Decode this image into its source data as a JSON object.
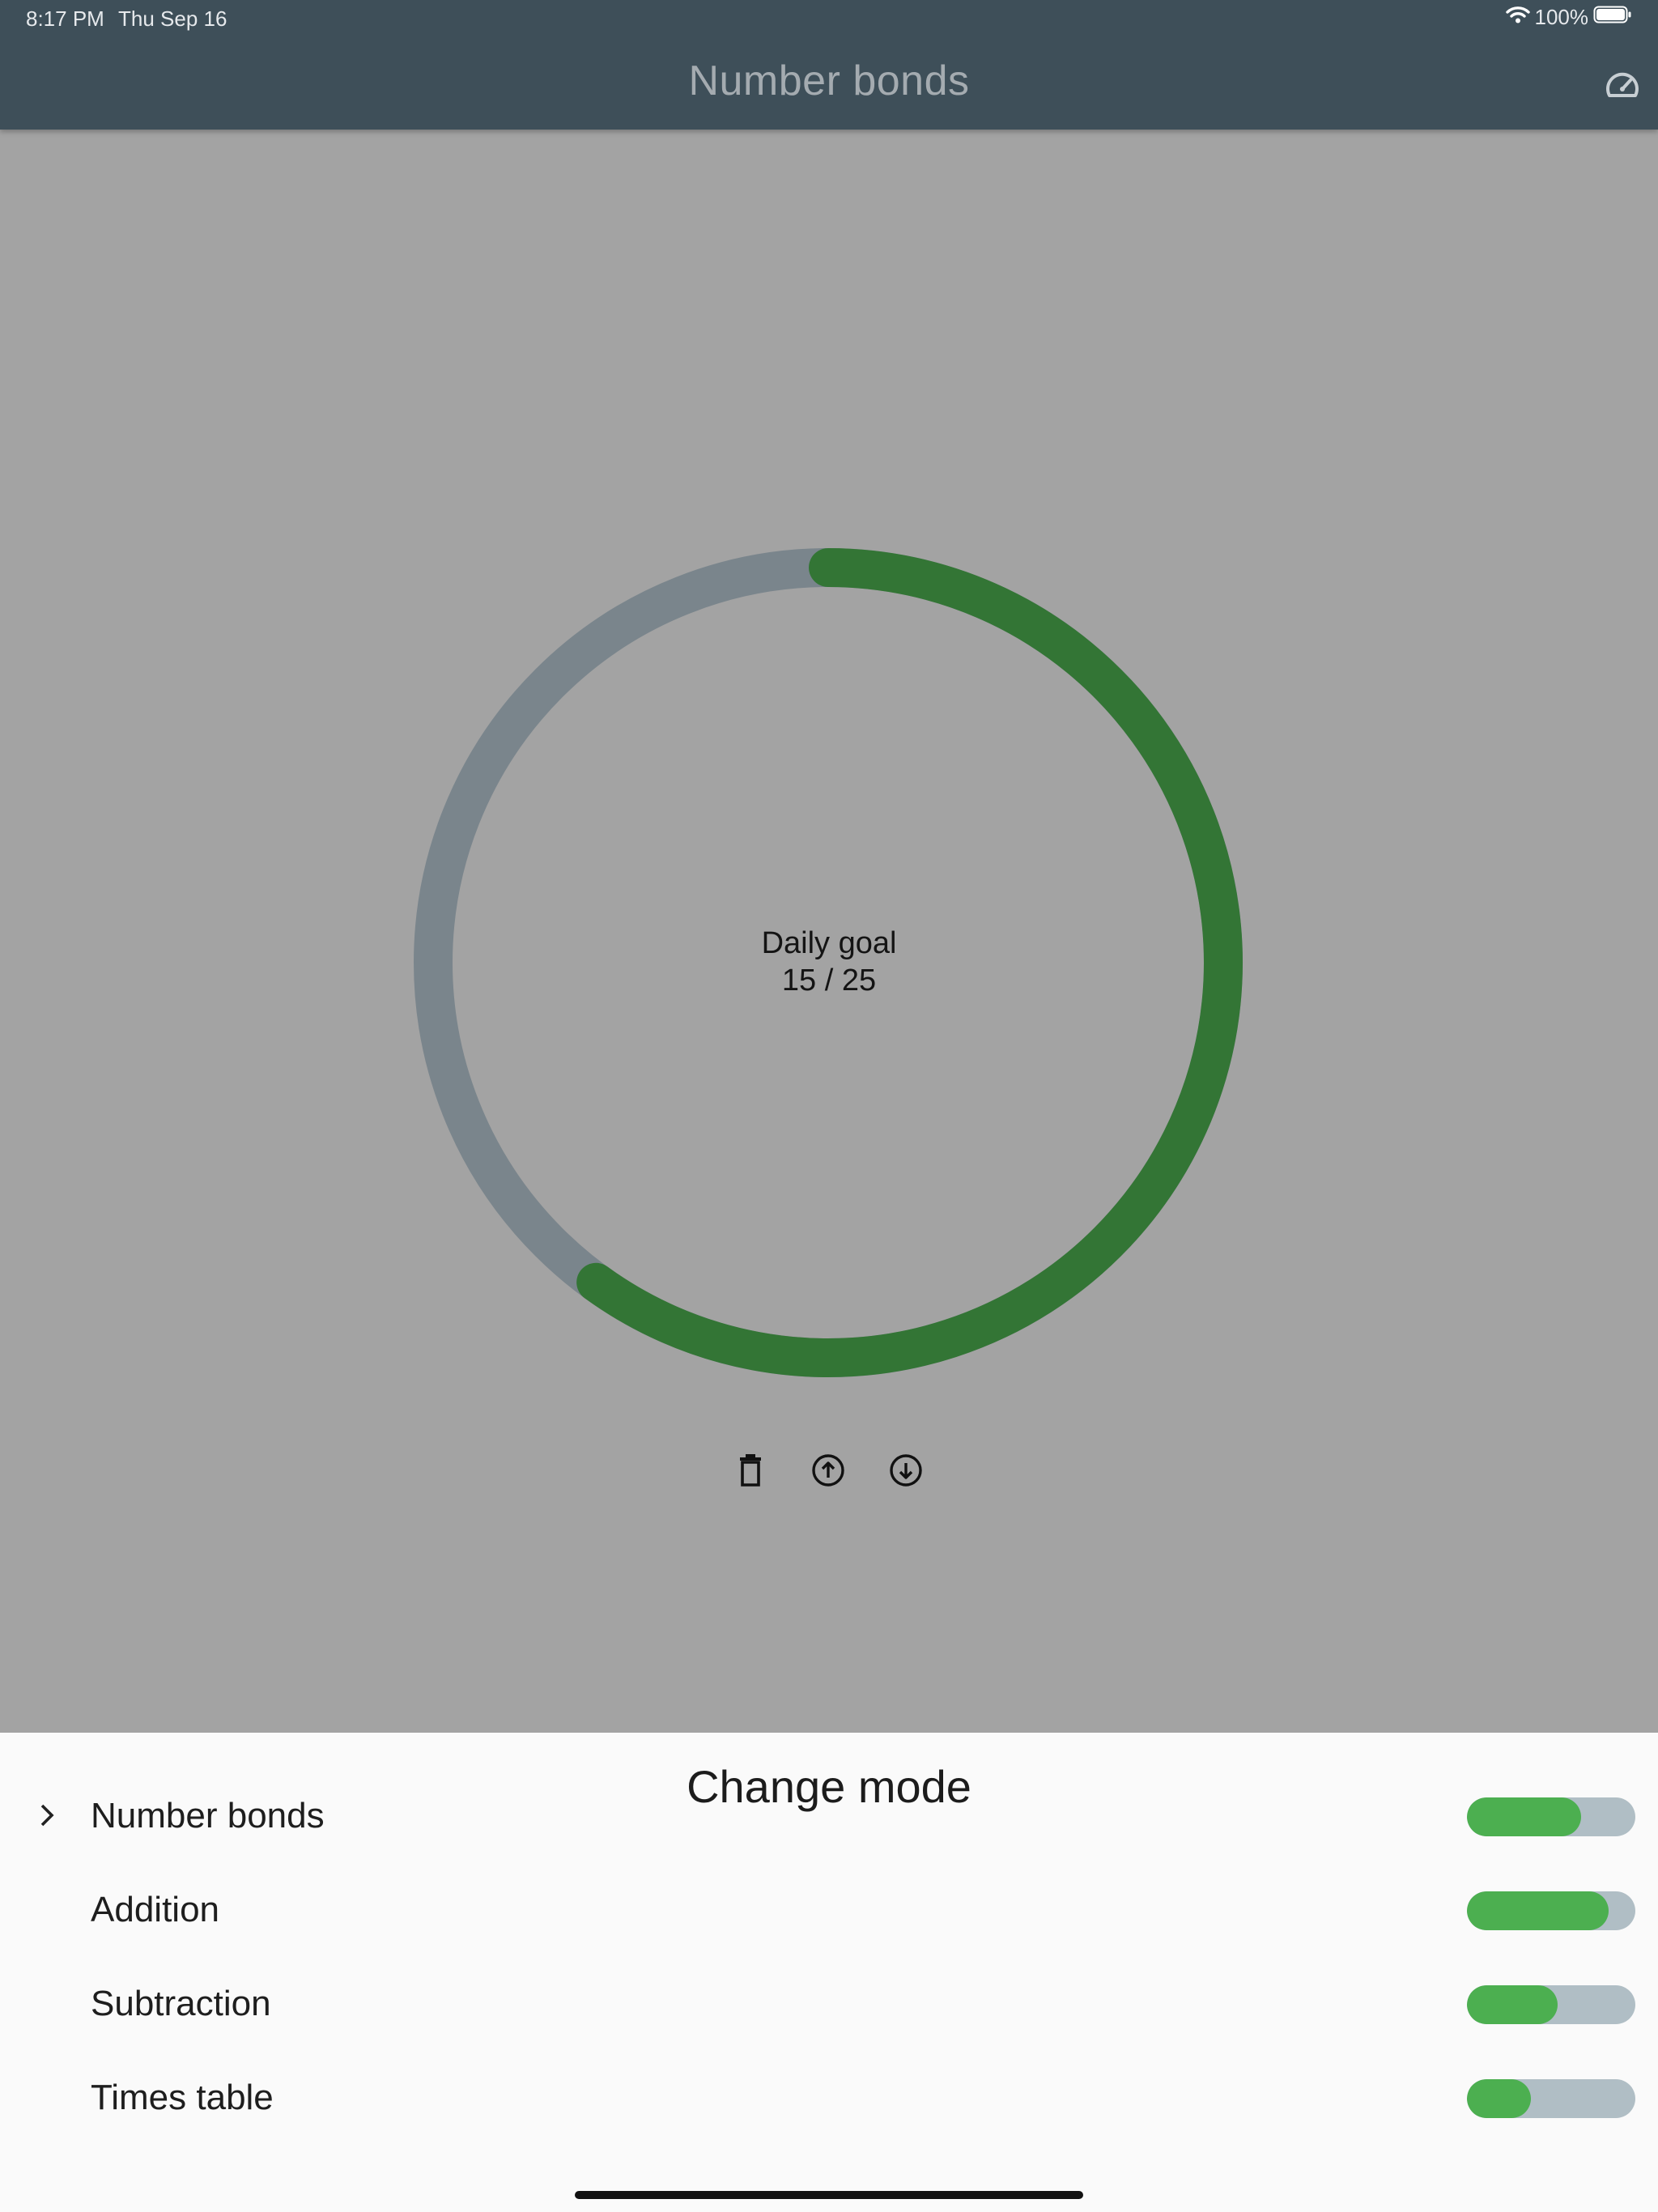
{
  "status_bar": {
    "time": "8:17 PM",
    "date": "Thu Sep 16",
    "battery": "100%"
  },
  "app_bar": {
    "title": "Number bonds"
  },
  "daily_goal": {
    "label": "Daily goal",
    "progress_text": "15 / 25",
    "done": 15,
    "goal": 25
  },
  "colors": {
    "progress": "#337535",
    "track": "#7a858c",
    "bar_fill": "#4caf50",
    "bar_track": "#b0bec5"
  },
  "sheet": {
    "title": "Change mode",
    "modes": [
      {
        "label": "Number bonds",
        "selected": true,
        "progress": 0.68
      },
      {
        "label": "Addition",
        "selected": false,
        "progress": 0.84
      },
      {
        "label": "Subtraction",
        "selected": false,
        "progress": 0.54
      },
      {
        "label": "Times table",
        "selected": false,
        "progress": 0.38
      }
    ]
  }
}
